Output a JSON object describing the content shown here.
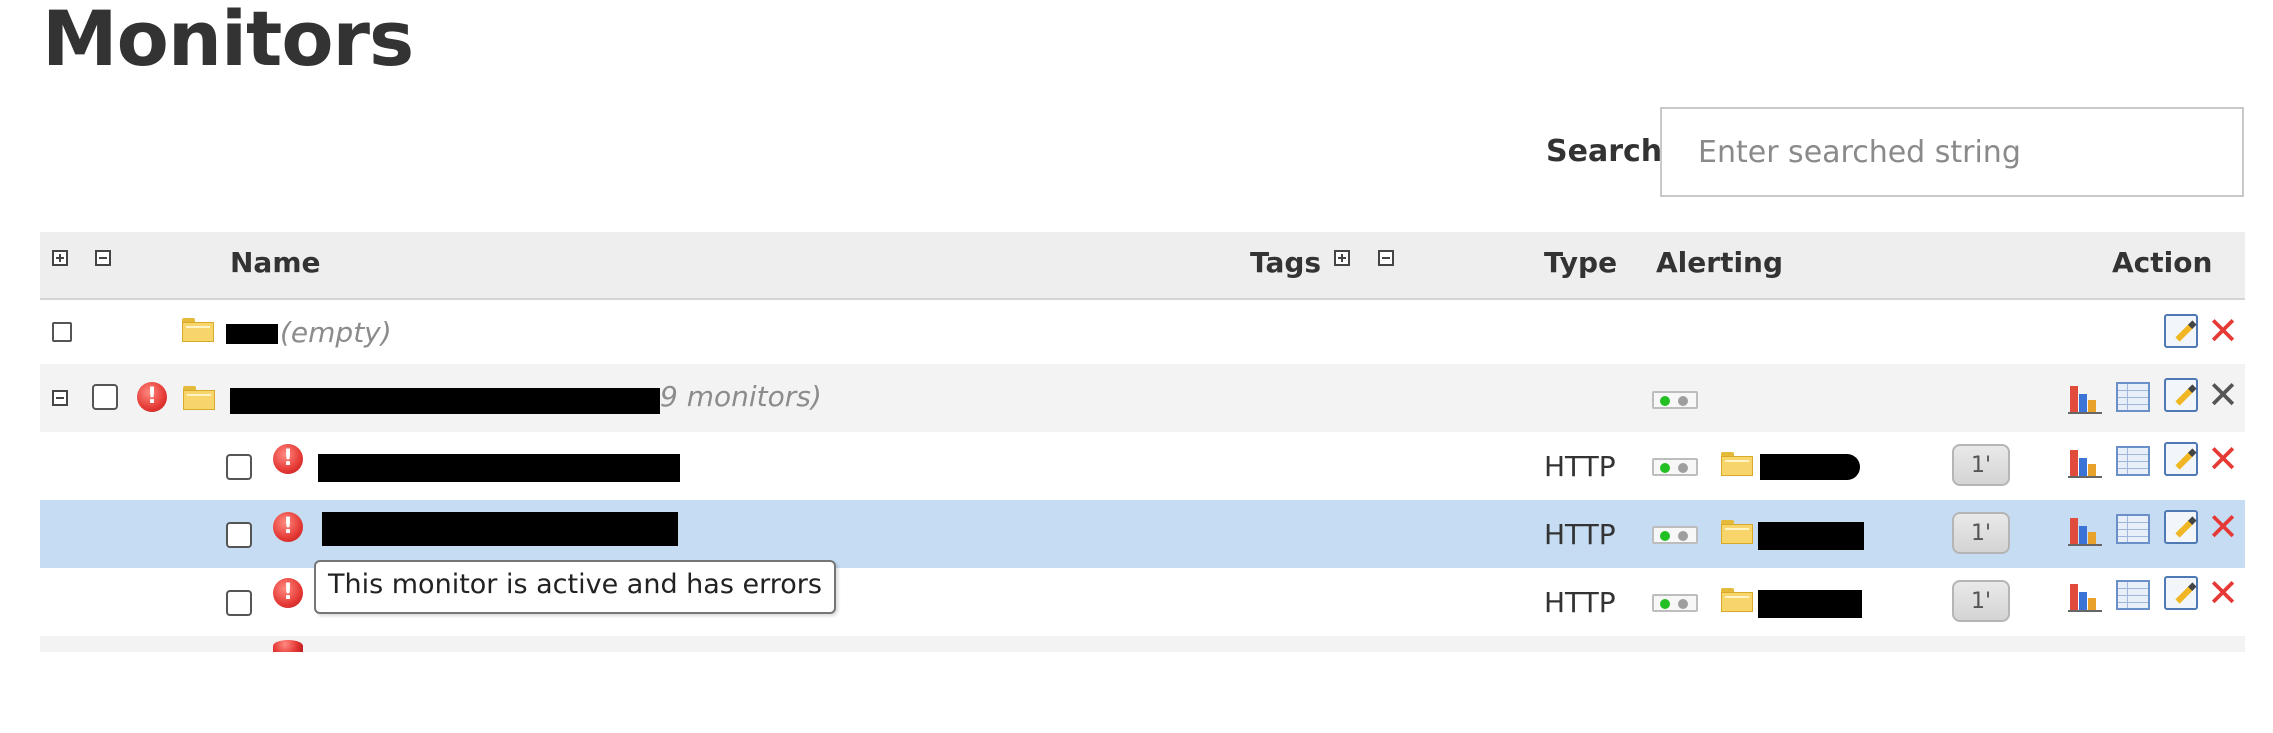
{
  "page": {
    "title": "Monitors"
  },
  "search": {
    "label": "Search",
    "placeholder": "Enter searched string"
  },
  "table": {
    "headers": {
      "name": "Name",
      "tags": "Tags",
      "type": "Type",
      "alerting": "Alerting",
      "action": "Action"
    },
    "rows": [
      {
        "kind": "folder",
        "name_suffix": "(empty)",
        "type": "",
        "interval": ""
      },
      {
        "kind": "folder",
        "name_suffix": "9 monitors)",
        "type": "",
        "interval": ""
      },
      {
        "kind": "monitor",
        "type": "HTTP",
        "interval": "1'"
      },
      {
        "kind": "monitor",
        "type": "HTTP",
        "interval": "1'",
        "selected": true
      },
      {
        "kind": "monitor",
        "type": "HTTP",
        "interval": "1'"
      }
    ]
  },
  "tooltip": {
    "text": "This monitor is active and has errors"
  },
  "colors": {
    "header_bg": "#eeeeee",
    "selected_row": "#c5dcf2",
    "error_red": "#e53935",
    "alert_green": "#22c022"
  }
}
